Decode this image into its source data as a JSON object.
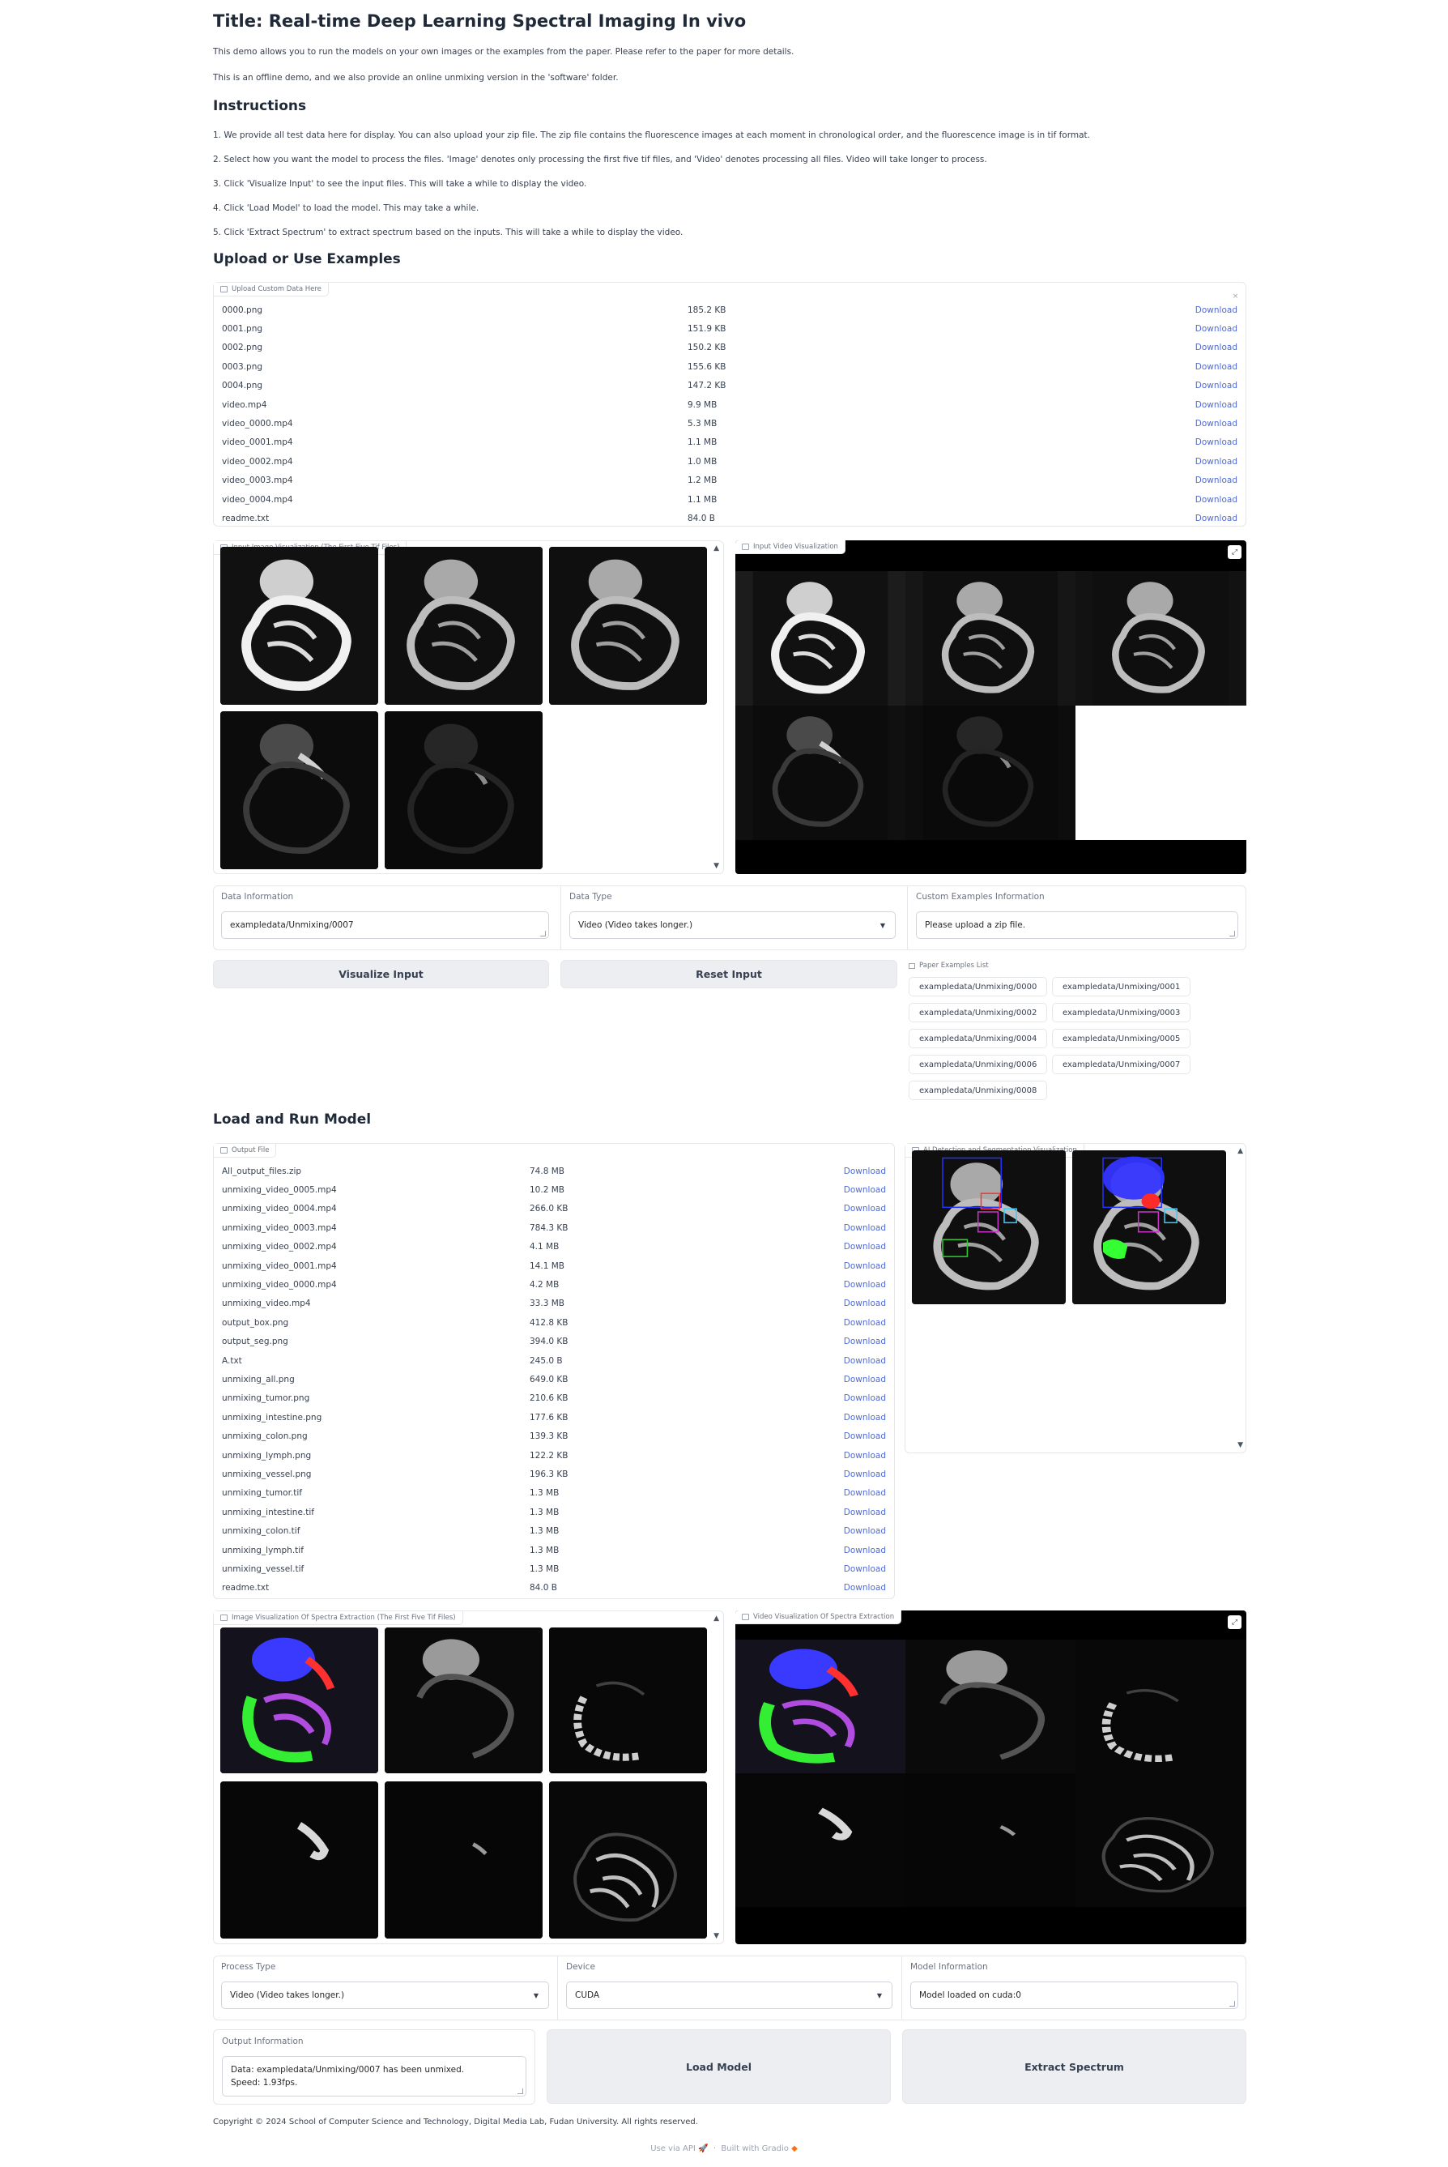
{
  "page": {
    "title": "Title: Real-time Deep Learning Spectral Imaging In vivo",
    "intro1": "This demo allows you to run the models on your own images or the examples from the paper. Please refer to the paper for more details.",
    "intro2": "This is an offline demo, and we also provide an online unmixing version in the 'software' folder.",
    "instructions_heading": "Instructions",
    "instructions": [
      "1. We provide all test data here for display. You can also upload your zip file. The zip file contains the fluorescence images at each moment in chronological order, and the fluorescence image is in tif format.",
      "2. Select how you want the model to process the files. 'Image' denotes only processing the first five tif files, and 'Video' denotes processing all files. Video will take longer to process.",
      "3. Click 'Visualize Input' to see the input files. This will take a while to display the video.",
      "4. Click 'Load Model' to load the model. This may take a while.",
      "5. Click 'Extract Spectrum' to extract spectrum based on the inputs. This will take a while to display the video."
    ],
    "upload_heading": "Upload or Use Examples",
    "load_heading": "Load and Run Model",
    "copyright": "Copyright © 2024 School of Computer Science and Technology, Digital Media Lab, Fudan University. All rights reserved.",
    "use_api": "Use via API",
    "built_with": "Built with Gradio"
  },
  "upload": {
    "label": "Upload Custom Data Here",
    "close": "×",
    "download_label": "Download",
    "files": [
      {
        "name": "0000.png",
        "size": "185.2 KB"
      },
      {
        "name": "0001.png",
        "size": "151.9 KB"
      },
      {
        "name": "0002.png",
        "size": "150.2 KB"
      },
      {
        "name": "0003.png",
        "size": "155.6 KB"
      },
      {
        "name": "0004.png",
        "size": "147.2 KB"
      },
      {
        "name": "video.mp4",
        "size": "9.9 MB"
      },
      {
        "name": "video_0000.mp4",
        "size": "5.3 MB"
      },
      {
        "name": "video_0001.mp4",
        "size": "1.1 MB"
      },
      {
        "name": "video_0002.mp4",
        "size": "1.0 MB"
      },
      {
        "name": "video_0003.mp4",
        "size": "1.2 MB"
      },
      {
        "name": "video_0004.mp4",
        "size": "1.1 MB"
      },
      {
        "name": "readme.txt",
        "size": "84.0 B"
      }
    ]
  },
  "input_gallery": {
    "label": "Input Image Visualization (The First Five Tif Files)"
  },
  "input_video": {
    "label": "Input Video Visualization"
  },
  "data_info": {
    "label": "Data Information",
    "value": "exampledata/Unmixing/0007"
  },
  "data_type": {
    "label": "Data Type",
    "value": "Video (Video takes longer.)"
  },
  "custom_info": {
    "label": "Custom Examples Information",
    "value": "Please upload a zip file."
  },
  "buttons": {
    "visualize": "Visualize Input",
    "reset": "Reset Input",
    "load_model": "Load Model",
    "extract": "Extract Spectrum"
  },
  "paper_examples": {
    "label": "Paper Examples List",
    "items": [
      "exampledata/Unmixing/0000",
      "exampledata/Unmixing/0001",
      "exampledata/Unmixing/0002",
      "exampledata/Unmixing/0003",
      "exampledata/Unmixing/0004",
      "exampledata/Unmixing/0005",
      "exampledata/Unmixing/0006",
      "exampledata/Unmixing/0007",
      "exampledata/Unmixing/0008"
    ]
  },
  "output": {
    "label": "Output File",
    "files": [
      {
        "name": "All_output_files.zip",
        "size": "74.8 MB"
      },
      {
        "name": "unmixing_video_0005.mp4",
        "size": "10.2 MB"
      },
      {
        "name": "unmixing_video_0004.mp4",
        "size": "266.0 KB"
      },
      {
        "name": "unmixing_video_0003.mp4",
        "size": "784.3 KB"
      },
      {
        "name": "unmixing_video_0002.mp4",
        "size": "4.1 MB"
      },
      {
        "name": "unmixing_video_0001.mp4",
        "size": "14.1 MB"
      },
      {
        "name": "unmixing_video_0000.mp4",
        "size": "4.2 MB"
      },
      {
        "name": "unmixing_video.mp4",
        "size": "33.3 MB"
      },
      {
        "name": "output_box.png",
        "size": "412.8 KB"
      },
      {
        "name": "output_seg.png",
        "size": "394.0 KB"
      },
      {
        "name": "A.txt",
        "size": "245.0 B"
      },
      {
        "name": "unmixing_all.png",
        "size": "649.0 KB"
      },
      {
        "name": "unmixing_tumor.png",
        "size": "210.6 KB"
      },
      {
        "name": "unmixing_intestine.png",
        "size": "177.6 KB"
      },
      {
        "name": "unmixing_colon.png",
        "size": "139.3 KB"
      },
      {
        "name": "unmixing_lymph.png",
        "size": "122.2 KB"
      },
      {
        "name": "unmixing_vessel.png",
        "size": "196.3 KB"
      },
      {
        "name": "unmixing_tumor.tif",
        "size": "1.3 MB"
      },
      {
        "name": "unmixing_intestine.tif",
        "size": "1.3 MB"
      },
      {
        "name": "unmixing_colon.tif",
        "size": "1.3 MB"
      },
      {
        "name": "unmixing_lymph.tif",
        "size": "1.3 MB"
      },
      {
        "name": "unmixing_vessel.tif",
        "size": "1.3 MB"
      },
      {
        "name": "readme.txt",
        "size": "84.0 B"
      }
    ]
  },
  "ai_detection": {
    "label": "AI Detection and Segmentation Visualization"
  },
  "spectra_gallery": {
    "label": "Image Visualization Of Spectra Extraction (The First Five Tif Files)"
  },
  "spectra_video": {
    "label": "Video Visualization Of Spectra Extraction"
  },
  "process_type": {
    "label": "Process Type",
    "value": "Video (Video takes longer.)"
  },
  "device": {
    "label": "Device",
    "value": "CUDA"
  },
  "model_info": {
    "label": "Model Information",
    "value": "Model loaded on cuda:0"
  },
  "output_info": {
    "label": "Output Information",
    "line1": "Data: exampledata/Unmixing/0007 has been unmixed.",
    "line2": "Speed: 1.93fps."
  },
  "colors": {
    "link": "#4f6bd6",
    "button_bg": "#eceef2",
    "border": "#e5e7eb"
  }
}
